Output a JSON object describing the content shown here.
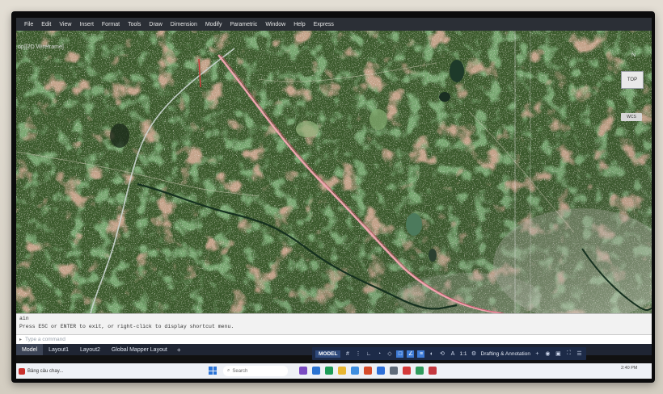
{
  "menu": {
    "items": [
      "File",
      "Edit",
      "View",
      "Insert",
      "Format",
      "Tools",
      "Draw",
      "Dimension",
      "Modify",
      "Parametric",
      "Window",
      "Help",
      "Express"
    ]
  },
  "viewport": {
    "label": "op][2D Wireframe]",
    "compass_north": "N",
    "viewcube_label": "TOP",
    "wcs_label": "WCS"
  },
  "command": {
    "history": [
      "ain",
      "Press ESC or ENTER to exit, or right-click to display shortcut menu."
    ],
    "placeholder": "Type a command"
  },
  "layout_tabs": {
    "items": [
      "Model",
      "Layout1",
      "Layout2",
      "Global Mapper Layout"
    ],
    "active_index": 0,
    "add_symbol": "+"
  },
  "status_bar": {
    "model_label": "MODEL",
    "scale": "1:1",
    "workspace": "Drafting & Annotation"
  },
  "taskbar": {
    "app_label": "Bảng cảu chay...",
    "search_label": "Search",
    "clock": "2:40 PM"
  },
  "colors": {
    "menubar": "#2b2f36",
    "map_base": "#35502a",
    "alignment_line": "#f0a5b0",
    "road_line": "#cfd9d6",
    "status_bar": "#1d2b48"
  }
}
